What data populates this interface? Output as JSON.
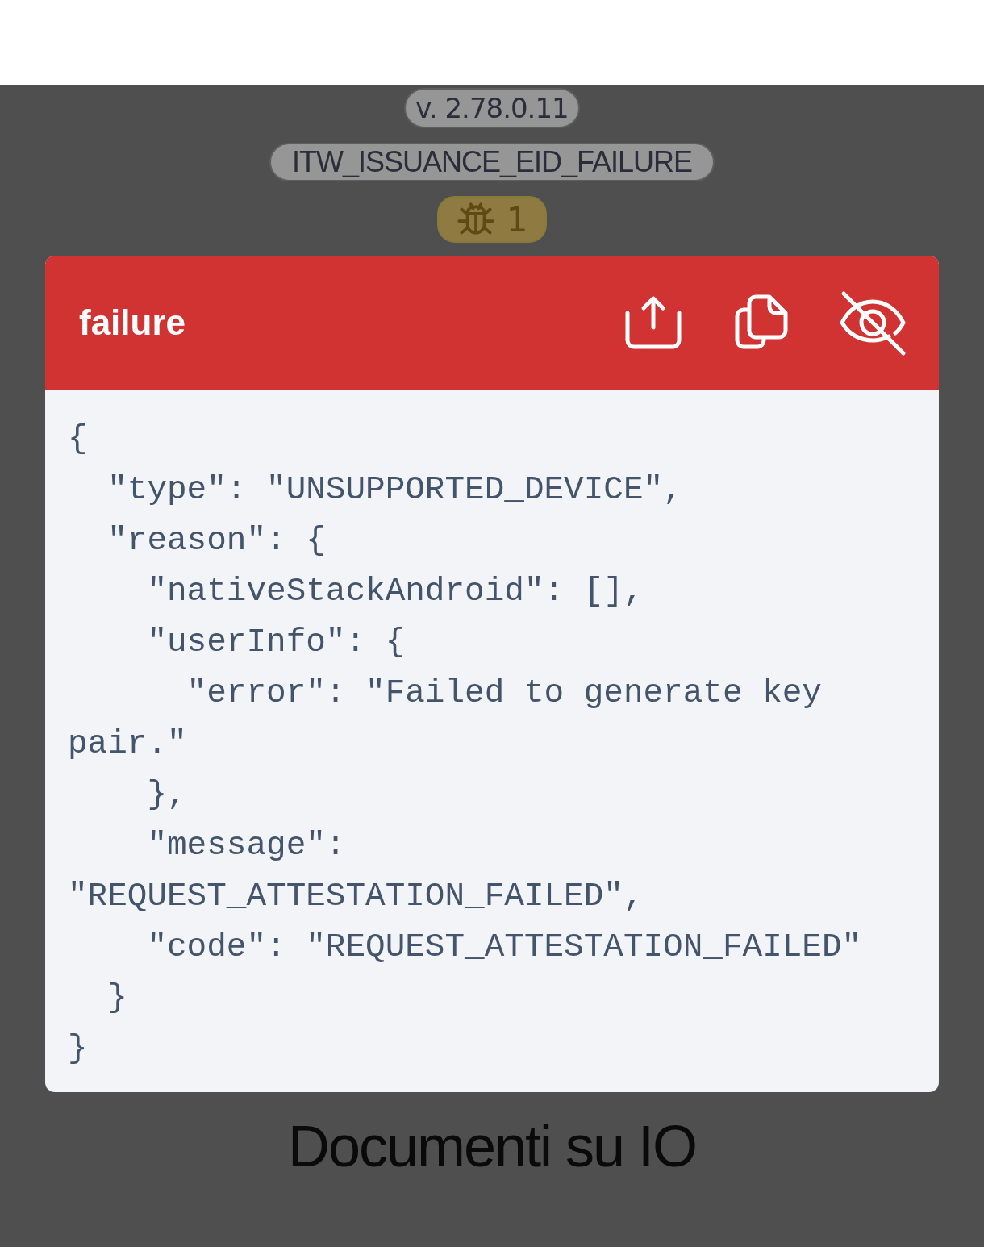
{
  "version_badge": "v. 2.78.0.11",
  "error_badge": "ITW_ISSUANCE_EID_FAILURE",
  "bug_badge": {
    "count": "1"
  },
  "card": {
    "title": "failure",
    "actions": [
      {
        "kind": "share"
      },
      {
        "kind": "copy"
      },
      {
        "kind": "hide"
      }
    ],
    "code_lines": [
      "{",
      "  \"type\": \"UNSUPPORTED_DEVICE\",",
      "  \"reason\": {",
      "    \"nativeStackAndroid\": [],",
      "    \"userInfo\": {",
      "      \"error\": \"Failed to generate key",
      "pair.\"",
      "    },",
      "    \"message\":",
      "\"REQUEST_ATTESTATION_FAILED\",",
      "    \"code\": \"REQUEST_ATTESTATION_FAILED\"",
      "  }",
      "}"
    ]
  },
  "heading": "Documenti su IO"
}
